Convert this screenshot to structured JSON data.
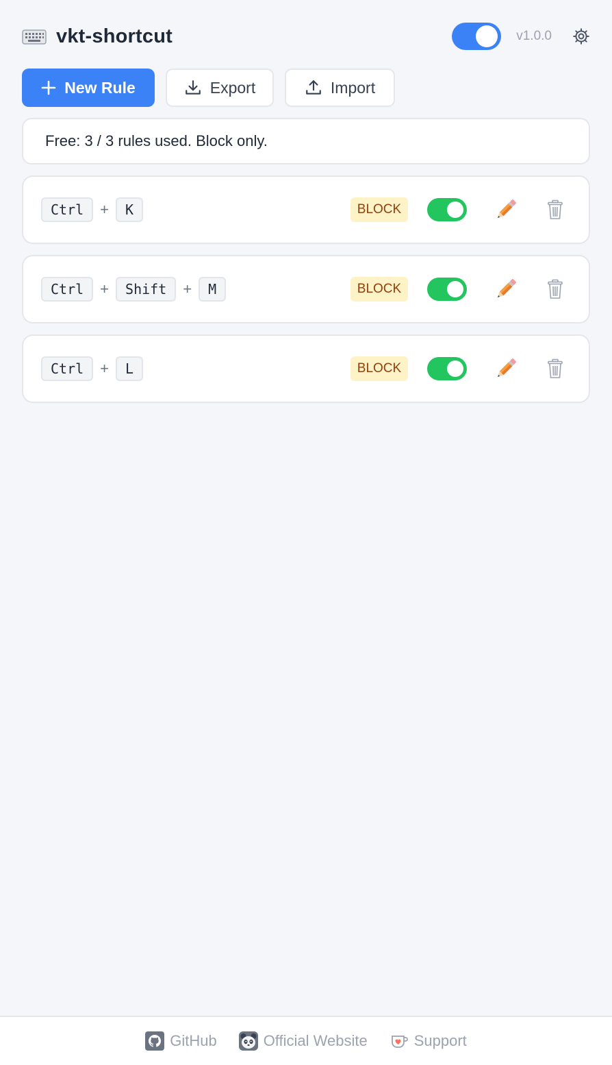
{
  "header": {
    "title": "vkt-shortcut",
    "logo_icon": "keyboard-icon",
    "master_enabled": true,
    "version": "v1.0.0",
    "settings_icon": "gear-icon",
    "accent_color": "#3b82f6"
  },
  "toolbar": {
    "new_rule_label": "New Rule",
    "export_label": "Export",
    "import_label": "Import"
  },
  "notice": {
    "text": "Free: 3 / 3 rules used. Block only."
  },
  "rules": [
    {
      "keys": [
        "Ctrl",
        "K"
      ],
      "action": "BLOCK",
      "enabled": true
    },
    {
      "keys": [
        "Ctrl",
        "Shift",
        "M"
      ],
      "action": "BLOCK",
      "enabled": true
    },
    {
      "keys": [
        "Ctrl",
        "L"
      ],
      "action": "BLOCK",
      "enabled": true
    }
  ],
  "rule_separator": "+",
  "colors": {
    "enabled_toggle": "#22c55e",
    "badge_bg": "#fef3c7",
    "badge_text": "#92400e"
  },
  "footer": {
    "links": [
      {
        "label": "GitHub",
        "icon": "github-icon"
      },
      {
        "label": "Official Website",
        "icon": "panda-icon"
      },
      {
        "label": "Support",
        "icon": "coffee-cup-icon"
      }
    ]
  }
}
